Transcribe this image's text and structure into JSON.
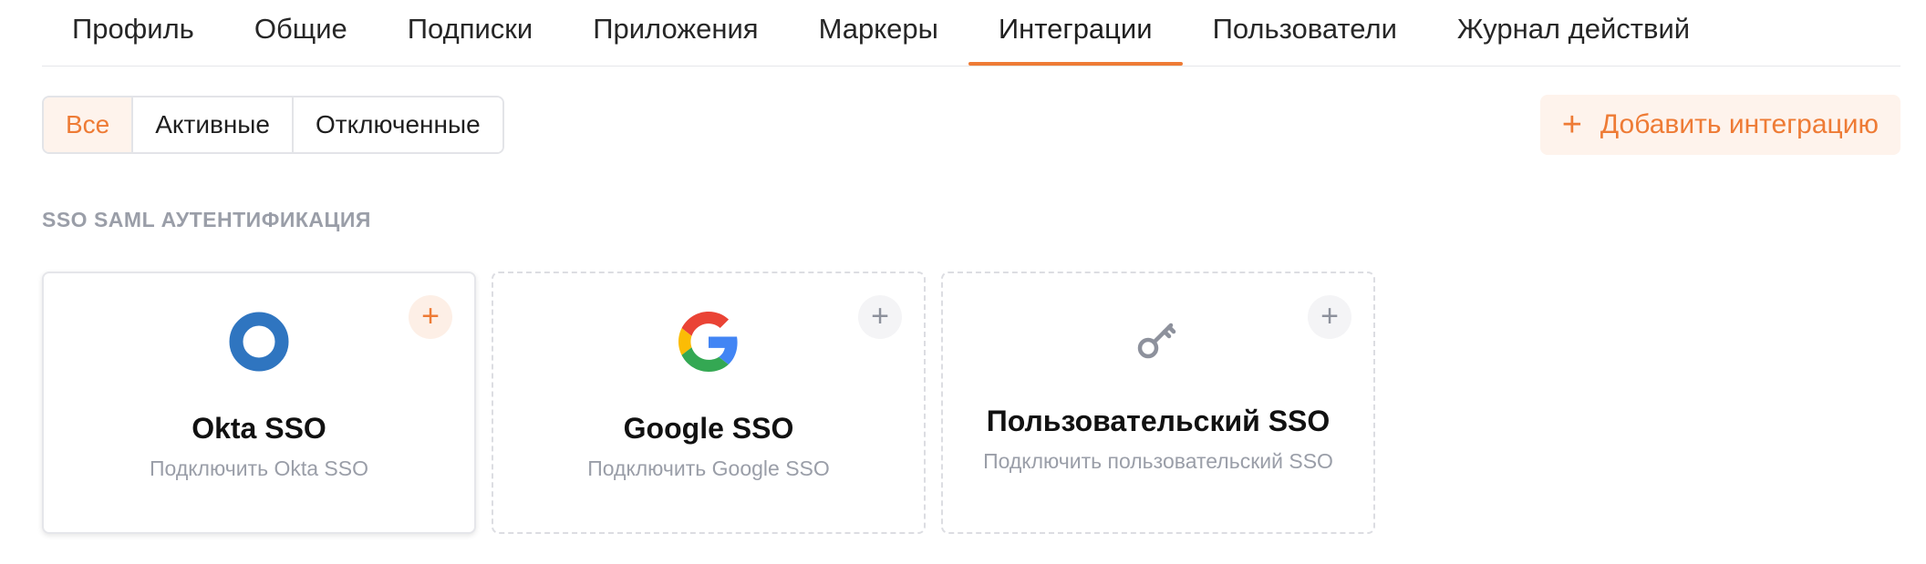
{
  "tabs": [
    {
      "label": "Профиль"
    },
    {
      "label": "Общие"
    },
    {
      "label": "Подписки"
    },
    {
      "label": "Приложения"
    },
    {
      "label": "Маркеры"
    },
    {
      "label": "Интеграции",
      "active": true
    },
    {
      "label": "Пользователи"
    },
    {
      "label": "Журнал действий"
    }
  ],
  "filters": {
    "all": "Все",
    "active": "Активные",
    "disabled": "Отключенные"
  },
  "add_integration": {
    "icon": "plus-icon",
    "label": "Добавить интеграцию"
  },
  "section": {
    "title": "SSO SAML АУТЕНТИФИКАЦИЯ"
  },
  "cards": [
    {
      "name": "Okta SSO",
      "desc": "Подключить Okta SSO",
      "icon": "okta-logo-icon"
    },
    {
      "name": "Google SSO",
      "desc": "Подключить Google SSO",
      "icon": "google-logo-icon"
    },
    {
      "name": "Пользовательский SSO",
      "desc": "Подключить пользовательский SSO",
      "icon": "key-icon"
    }
  ],
  "colors": {
    "accent": "#ee7b35",
    "muted": "#9a9ea8",
    "okta": "#2f75c0"
  }
}
